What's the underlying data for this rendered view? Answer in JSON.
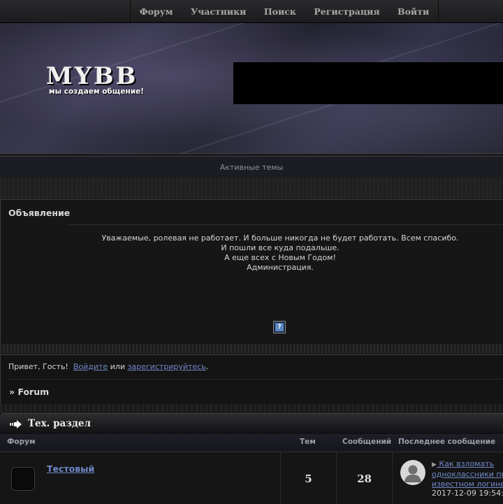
{
  "nav": {
    "items": [
      "Форум",
      "Участники",
      "Поиск",
      "Регистрация",
      "Войти"
    ]
  },
  "banner": {
    "logo_title": "MYBB",
    "logo_subtitle": "мы создаем общение!"
  },
  "active_topics": "Активные темы",
  "announcement": {
    "title": "Объявление",
    "lines": [
      "Уважаемые, ролевая не работает. И больше никогда не будет работать. Всем спасибо.",
      "И пошли все куда подальше.",
      "А еще всех с Новым Годом!",
      "Администрация."
    ],
    "help_icon": "help-icon"
  },
  "greeting": {
    "prefix": "Привет, Гость!",
    "login_link": "Войдите",
    "or": "или",
    "register_link": "зарегистрируйтесь",
    "suffix": "."
  },
  "breadcrumb": {
    "arrow": "»",
    "label": "Forum"
  },
  "category": {
    "title": "Тех. раздел",
    "columns": {
      "forum": "Форум",
      "topics": "Тем",
      "posts": "Сообщений",
      "last_post": "Последнее сообщение"
    },
    "rows": [
      {
        "name": "Тестовый",
        "topics": "5",
        "posts": "28",
        "last_post_arrow": "▶",
        "last_post_title": "Как взломать одноклассники пр... известном логине",
        "last_post_line1": "Как взломать",
        "last_post_line2": "одноклассники пр",
        "last_post_line3": "известном логине",
        "last_post_date": "2017-12-09 19:54:"
      }
    ]
  },
  "colors": {
    "link": "#6f88c8",
    "background": "#1a1a1b",
    "text": "#cfcfcf"
  }
}
